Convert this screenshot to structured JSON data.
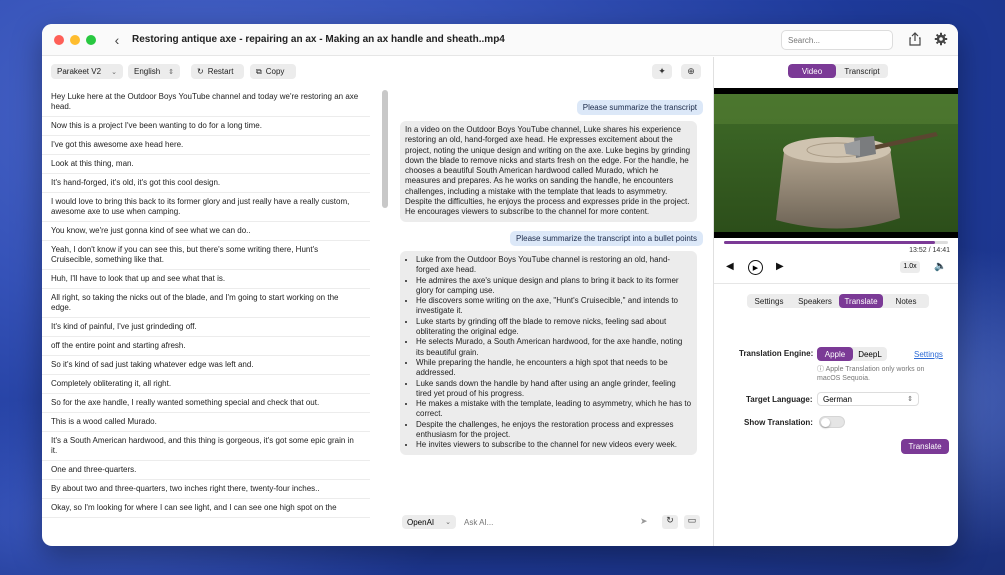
{
  "window": {
    "title": "Restoring antique axe - repairing an ax - Making an ax handle and sheath..mp4",
    "search_placeholder": "Search..."
  },
  "toolbar": {
    "model": "Parakeet V2",
    "language": "English",
    "restart_label": "Restart",
    "copy_label": "Copy"
  },
  "transcript": {
    "lines": [
      "Hey Luke here at the Outdoor Boys YouTube channel and today we're restoring an axe head.",
      "Now this is a project I've been wanting to do for a long time.",
      "I've got this awesome axe head here.",
      "Look at this thing, man.",
      "It's hand-forged, it's old, it's got this cool design.",
      "I would love to bring this back to its former glory and just really have a really custom, awesome axe to use when camping.",
      "You know, we're just gonna kind of see what we can do..",
      "Yeah, I don't know if you can see this, but there's some writing there, Hunt's Cruisecible, something like that.",
      "Huh, I'll have to look that up and see what that is.",
      "All right, so taking the nicks out of the blade, and I'm going to start working on the edge.",
      "It's kind of painful, I've just grindeding off.",
      "off the entire point and starting afresh.",
      "So it's kind of sad just taking whatever edge was left and.",
      "Completely obliterating it, all right.",
      "So for the axe handle, I really wanted something special and check that out.",
      "This is a wood called Murado.",
      "It's a South American hardwood, and this thing is gorgeous, it's got some epic grain in it.",
      "One and three-quarters.",
      "By about two and three-quarters, two inches right there, twenty-four inches..",
      "Okay, so I'm looking for where I can see light, and I can see one high spot on the"
    ]
  },
  "chat": {
    "user_msg_1": "Please summarize the transcript",
    "ai_msg_1": "In a video on the Outdoor Boys YouTube channel, Luke shares his experience restoring an old, hand-forged axe head. He expresses excitement about the project, noting the unique design and writing on the axe. Luke begins by grinding down the blade to remove nicks and starts fresh on the edge. For the handle, he chooses a beautiful South American hardwood called Murado, which he measures and prepares. As he works on sanding the handle, he encounters challenges, including a mistake with the template that leads to asymmetry. Despite the difficulties, he enjoys the process and expresses pride in the project. He encourages viewers to subscribe to the channel for more content.",
    "user_msg_2": "Please summarize the transcript into a bullet points",
    "bullets": [
      "Luke from the Outdoor Boys YouTube channel is restoring an old, hand-forged axe head.",
      "He admires the axe's unique design and plans to bring it back to its former glory for camping use.",
      "He discovers some writing on the axe, \"Hunt's Cruisecible,\" and intends to investigate it.",
      "Luke starts by grinding off the blade to remove nicks, feeling sad about obliterating the original edge.",
      "He selects Murado, a South American hardwood, for the axe handle, noting its beautiful grain.",
      "While preparing the handle, he encounters a high spot that needs to be addressed.",
      "Luke sands down the handle by hand after using an angle grinder, feeling tired yet proud of his progress.",
      "He makes a mistake with the template, leading to asymmetry, which he has to correct.",
      "Despite the challenges, he enjoys the restoration process and expresses enthusiasm for the project.",
      "He invites viewers to subscribe to the channel for new videos every week."
    ],
    "provider": "OpenAI",
    "ask_placeholder": "Ask AI..."
  },
  "player": {
    "tab_video": "Video",
    "tab_transcript": "Transcript",
    "time": "13:52 / 14:41",
    "progress": 0.944,
    "speed": "1.0x"
  },
  "panel": {
    "tabs": [
      "Settings",
      "Speakers",
      "Translate",
      "Notes"
    ],
    "active_tab": "Translate",
    "engine_label": "Translation Engine:",
    "engine_apple": "Apple",
    "engine_deepl": "DeepL",
    "settings_link": "Settings",
    "note": "Apple Translation only works on macOS Sequoia.",
    "target_label": "Target Language:",
    "target_value": "German",
    "show_label": "Show Translation:",
    "translate_button": "Translate"
  },
  "colors": {
    "accent": "#7b3a96",
    "user_bubble": "#dce8f8",
    "ai_bubble": "#ececec"
  }
}
